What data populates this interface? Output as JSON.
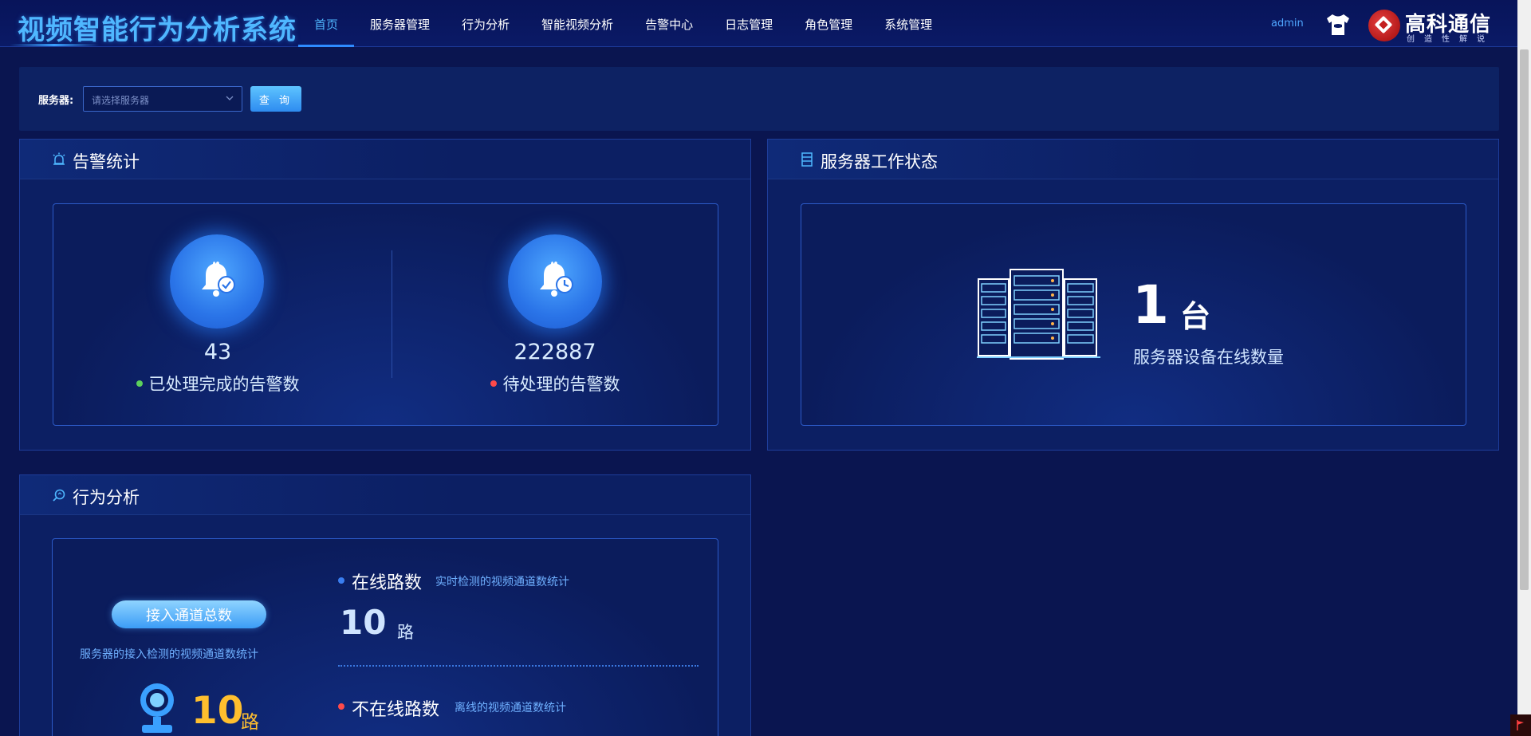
{
  "header": {
    "title": "视频智能行为分析系统",
    "nav": [
      {
        "label": "首页",
        "active": true
      },
      {
        "label": "服务器管理",
        "active": false
      },
      {
        "label": "行为分析",
        "active": false
      },
      {
        "label": "智能视频分析",
        "active": false
      },
      {
        "label": "告警中心",
        "active": false
      },
      {
        "label": "日志管理",
        "active": false
      },
      {
        "label": "角色管理",
        "active": false
      },
      {
        "label": "系统管理",
        "active": false
      }
    ],
    "username": "admin",
    "logo_name": "高科通信",
    "logo_slogan": "创造性解说"
  },
  "filter": {
    "label": "服务器:",
    "select_placeholder": "请选择服务器",
    "query_label": "查 询"
  },
  "alarm_panel": {
    "title": "告警统计",
    "processed_count": "43",
    "processed_label": "已处理完成的告警数",
    "pending_count": "222887",
    "pending_label": "待处理的告警数"
  },
  "server_panel": {
    "title": "服务器工作状态",
    "count": "1",
    "unit": "台",
    "label": "服务器设备在线数量"
  },
  "behavior_panel": {
    "title": "行为分析",
    "total_button": "接入通道总数",
    "total_desc": "服务器的接入检测的视频通道数统计",
    "total_number": "10",
    "total_unit": "路",
    "online_title": "在线路数",
    "online_desc": "实时检测的视频通道数统计",
    "online_number": "10",
    "online_unit": "路",
    "offline_title": "不在线路数",
    "offline_desc": "离线的视频通道数统计"
  },
  "colors": {
    "accent": "#4fb7ff",
    "processed_dot": "#5cd05c",
    "pending_dot": "#ff4a4a",
    "online_dot": "#3a7ef0",
    "offline_dot": "#ff4a4a",
    "total_number": "#ffbf2e"
  }
}
